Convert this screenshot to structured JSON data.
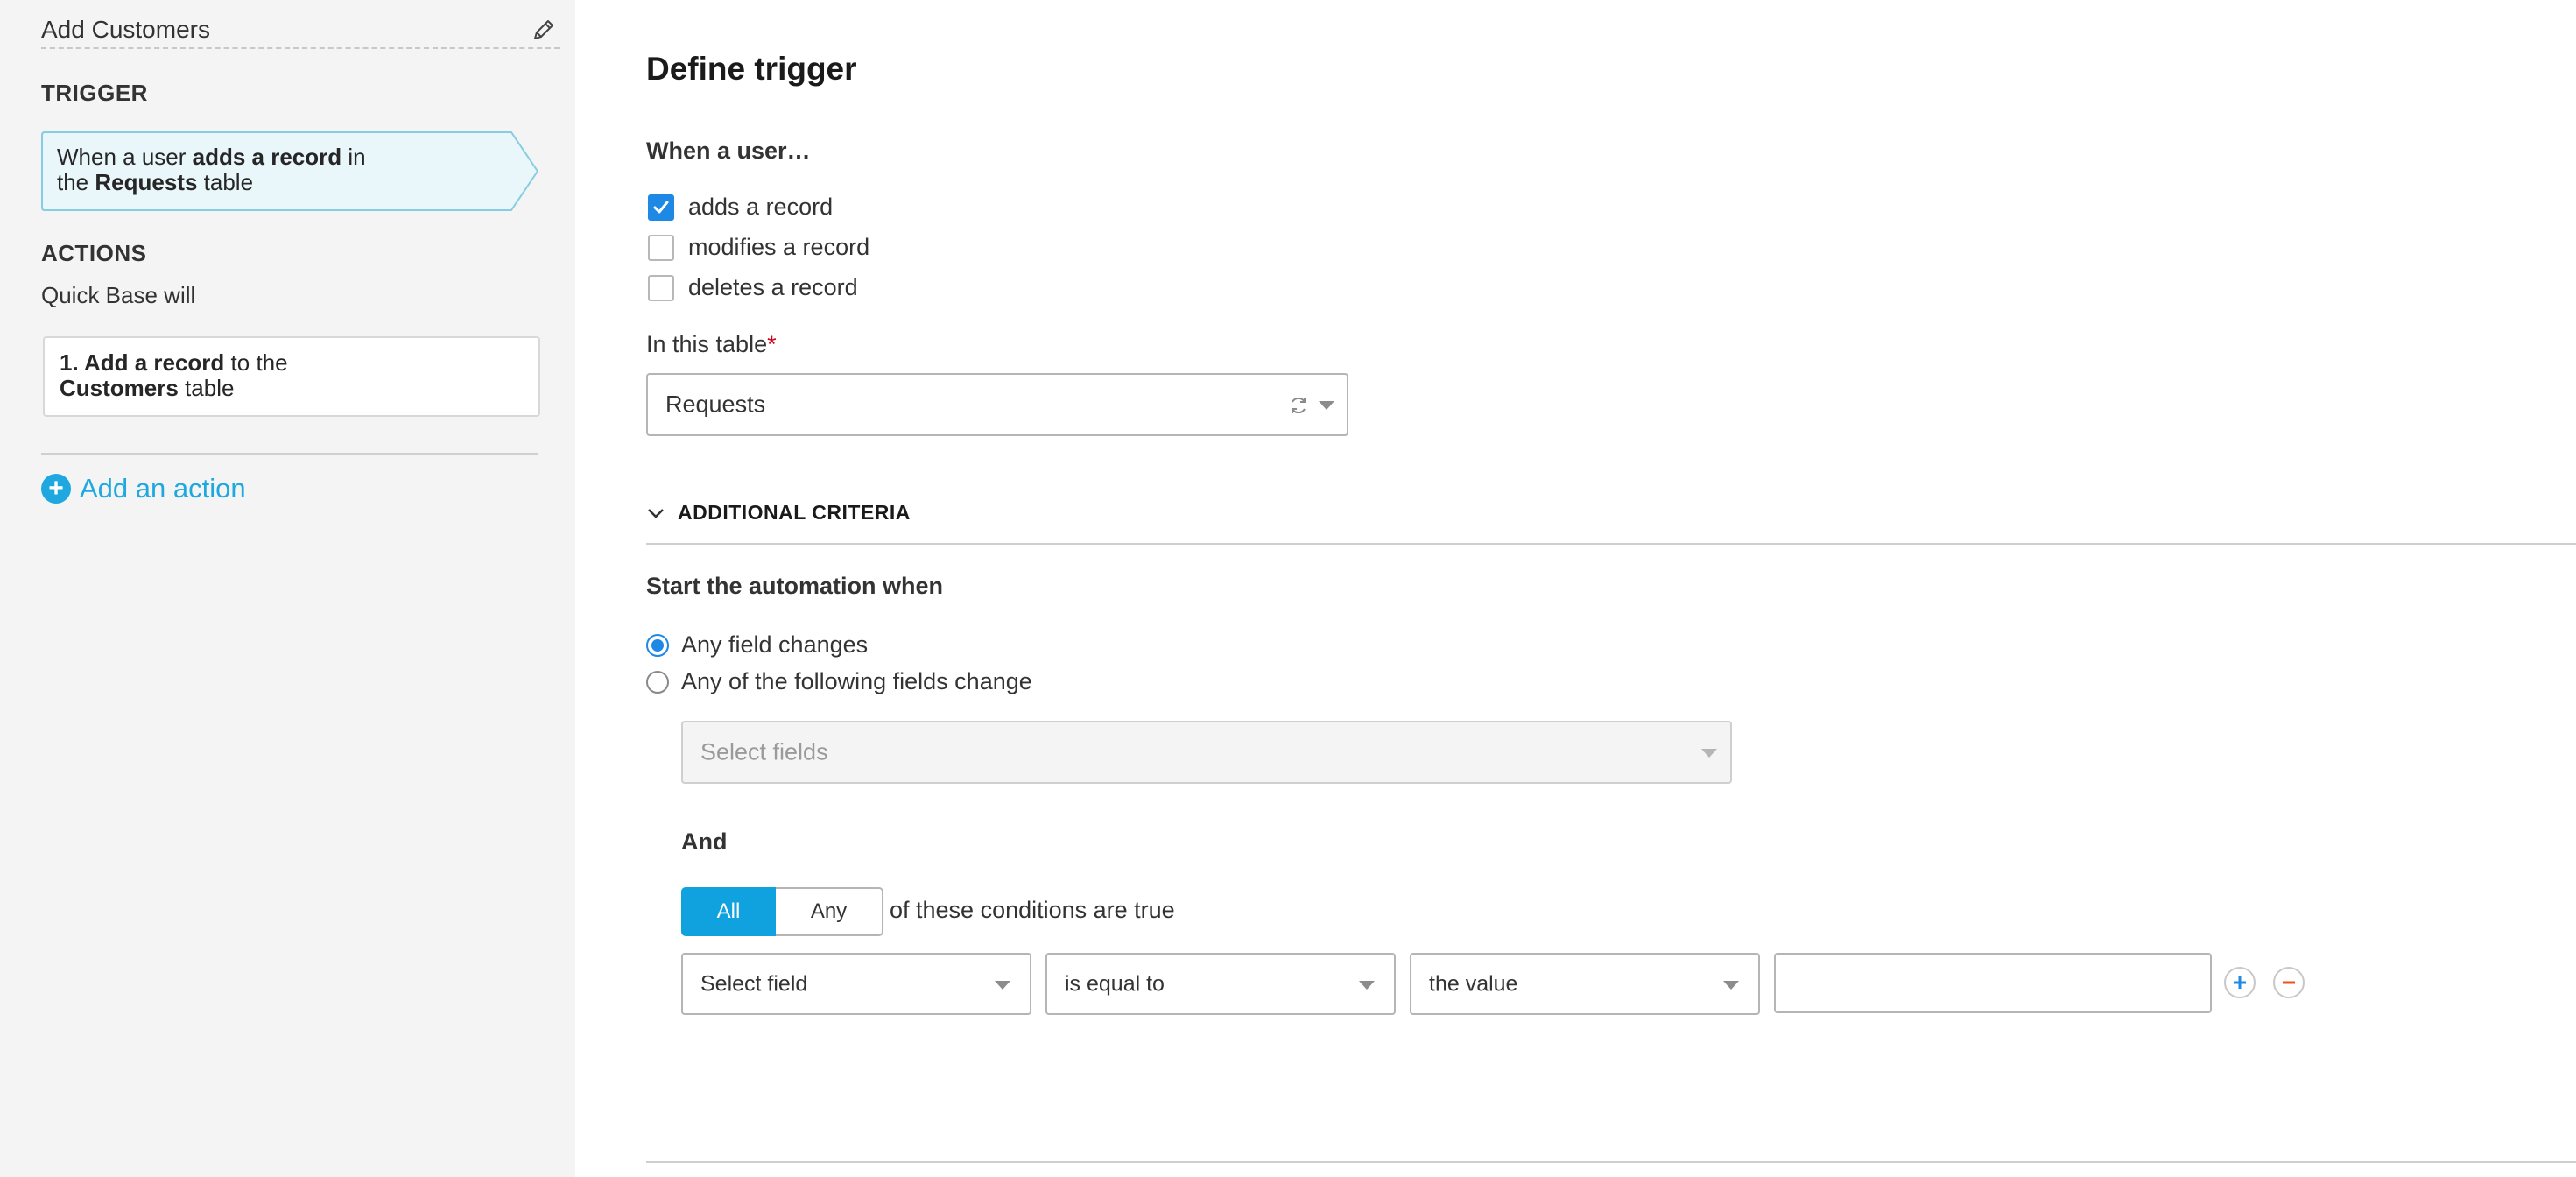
{
  "sidebar": {
    "title": "Add Customers",
    "trigger_heading": "TRIGGER",
    "trigger_card": {
      "part1": "When a user ",
      "bold1": "adds a record",
      "part2": " in",
      "part3": "the ",
      "bold2": "Requests",
      "part4": " table"
    },
    "actions_heading": "ACTIONS",
    "actions_sub": "Quick Base will",
    "action_card": {
      "bold1": "1. Add a record",
      "part1": " to the",
      "bold2": "Customers",
      "part2": " table"
    },
    "add_action_label": "Add an action",
    "icons": {
      "edit": "pencil-icon",
      "add": "plus-circle-icon"
    }
  },
  "main": {
    "title": "Define trigger",
    "when_label": "When a user…",
    "checkboxes": [
      {
        "label": "adds a record",
        "checked": true
      },
      {
        "label": "modifies a record",
        "checked": false
      },
      {
        "label": "deletes a record",
        "checked": false
      }
    ],
    "table_label": "In this table",
    "required_mark": "*",
    "table_value": "Requests",
    "additional_criteria": "ADDITIONAL CRITERIA",
    "start_label": "Start the automation when",
    "radios": [
      {
        "label": "Any field changes",
        "selected": true
      },
      {
        "label": "Any of the following fields change",
        "selected": false
      }
    ],
    "select_fields_placeholder": "Select fields",
    "and_label": "And",
    "segment": {
      "all": "All",
      "any": "Any",
      "selected": "All"
    },
    "conditions_suffix": "of these conditions are true",
    "condition": {
      "field": "Select field",
      "operator": "is equal to",
      "value_type": "the value",
      "value": ""
    },
    "accent_color": "#0fa2de",
    "remove_color": "#e8541e"
  }
}
